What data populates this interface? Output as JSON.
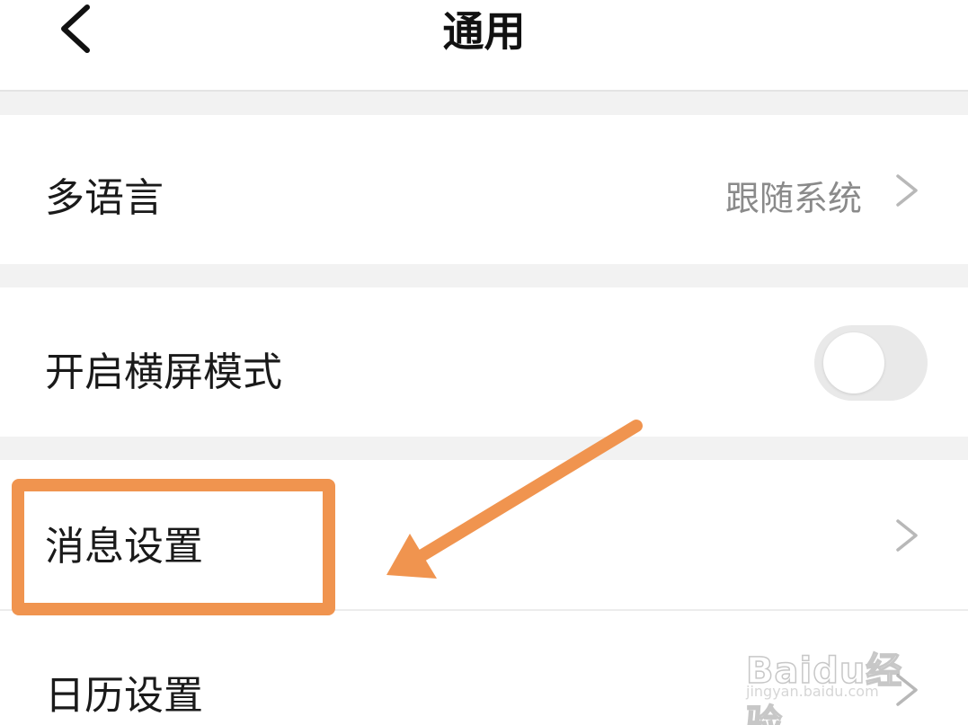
{
  "header": {
    "title": "通用",
    "back_icon": "chevron-left-icon"
  },
  "settings": {
    "language": {
      "label": "多语言",
      "value": "跟随系统",
      "icon": "chevron-right-icon"
    },
    "landscape_mode": {
      "label": "开启横屏模式",
      "toggle_on": false
    },
    "message_settings": {
      "label": "消息设置",
      "icon": "chevron-right-icon"
    },
    "calendar_settings": {
      "label": "日历设置",
      "icon": "chevron-right-icon"
    }
  },
  "annotation": {
    "color": "#f0944f",
    "highlight_target": "消息设置"
  },
  "watermark": {
    "logo": "Baidu经验",
    "url": "jingyan.baidu.com"
  },
  "colors": {
    "background": "#f2f2f2",
    "row": "#ffffff",
    "text": "#1a1a1a",
    "secondary_text": "#8a8a8a",
    "toggle_off": "#e9e9e9"
  }
}
